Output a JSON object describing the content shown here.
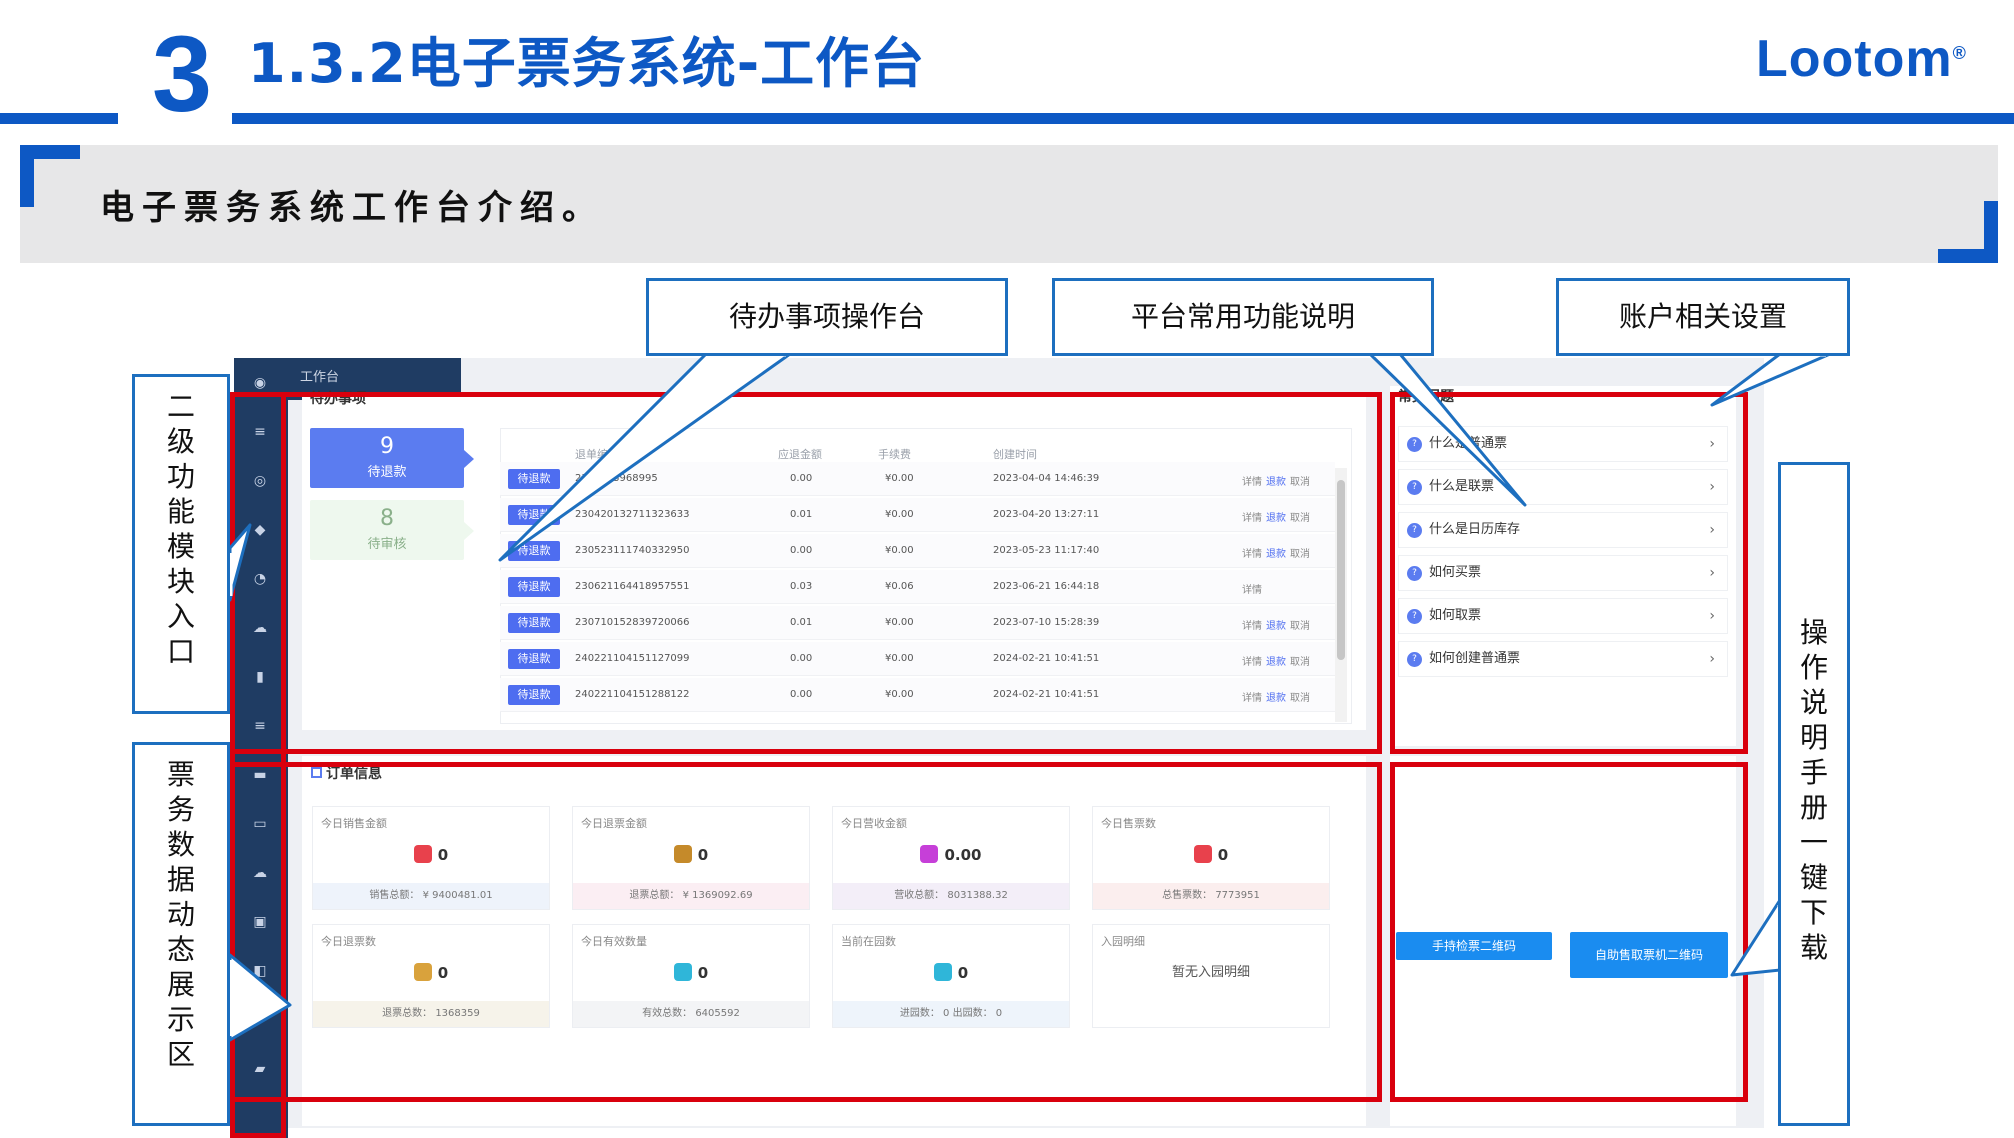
{
  "slide": {
    "number": "3",
    "title": "1.3.2电子票务系统-工作台",
    "logo": "Lootom",
    "logo_mark": "®",
    "subtitle": "电子票务系统工作台介绍。",
    "brand_color": "#0d58c4",
    "frame_color": "#d9000d"
  },
  "callouts": {
    "todo": "待办事项操作台",
    "platform": "平台常用功能说明",
    "account": "账户相关设置",
    "module": "二级功能模块入口",
    "data": "票务数据动态展示区",
    "manual": "操作说明手册一键下载"
  },
  "app": {
    "breadcrumb": "工作台",
    "sidebar_icons": [
      "dashboard-icon",
      "menu-icon",
      "apps-icon",
      "diamond-icon",
      "pie-chart-icon",
      "cloud-icon",
      "document-icon",
      "list-icon",
      "card-icon",
      "screen-icon",
      "cloud-upload-icon",
      "calendar-icon",
      "qr-icon",
      "dropbox-icon",
      "wallet-icon"
    ],
    "todo": {
      "title": "待办事项",
      "cards": [
        {
          "count": "9",
          "label": "待退款"
        },
        {
          "count": "8",
          "label": "待审核"
        }
      ],
      "columns": [
        "退单编号",
        "应退金额",
        "手续费",
        "创建时间"
      ],
      "rows": [
        {
          "tag": "待退款",
          "id": "2304463968995",
          "amount": "0.00",
          "fee": "¥0.00",
          "time": "2023-04-04 14:46:39",
          "detail": "详情",
          "refund": "退款",
          "cancel": "取消"
        },
        {
          "tag": "待退款",
          "id": "230420132711323633",
          "amount": "0.01",
          "fee": "¥0.00",
          "time": "2023-04-20 13:27:11",
          "detail": "详情",
          "refund": "退款",
          "cancel": "取消"
        },
        {
          "tag": "待退款",
          "id": "230523111740332950",
          "amount": "0.00",
          "fee": "¥0.00",
          "time": "2023-05-23 11:17:40",
          "detail": "详情",
          "refund": "退款",
          "cancel": "取消"
        },
        {
          "tag": "待退款",
          "id": "230621164418957551",
          "amount": "0.03",
          "fee": "¥0.06",
          "time": "2023-06-21 16:44:18",
          "detail": "详情",
          "refund": "",
          "cancel": ""
        },
        {
          "tag": "待退款",
          "id": "230710152839720066",
          "amount": "0.01",
          "fee": "¥0.00",
          "time": "2023-07-10 15:28:39",
          "detail": "详情",
          "refund": "退款",
          "cancel": "取消"
        },
        {
          "tag": "待退款",
          "id": "240221104151127099",
          "amount": "0.00",
          "fee": "¥0.00",
          "time": "2024-02-21 10:41:51",
          "detail": "详情",
          "refund": "退款",
          "cancel": "取消"
        },
        {
          "tag": "待退款",
          "id": "240221104151288122",
          "amount": "0.00",
          "fee": "¥0.00",
          "time": "2024-02-21 10:41:51",
          "detail": "详情",
          "refund": "退款",
          "cancel": "取消"
        }
      ]
    },
    "faq": {
      "title": "常见问题",
      "items": [
        "什么是普通票",
        "什么是联票",
        "什么是日历库存",
        "如何买票",
        "如何取票",
        "如何创建普通票"
      ]
    },
    "orders": {
      "title": "订单信息",
      "cards": [
        {
          "title": "今日销售金额",
          "value": "0",
          "footer": "销售总额：  ¥ 9400481.01",
          "icon_color": "#e8414c",
          "foot_bg": "#eef3fb"
        },
        {
          "title": "今日退票金额",
          "value": "0",
          "footer": "退票总额：  ¥ 1369092.69",
          "icon_color": "#c58a2a",
          "foot_bg": "#fbeef3"
        },
        {
          "title": "今日营收金额",
          "value": "0.00",
          "footer": "营收总额：  8031388.32",
          "icon_color": "#c63fd8",
          "foot_bg": "#f3eef8"
        },
        {
          "title": "今日售票数",
          "value": "0",
          "footer": "总售票数：  7773951",
          "icon_color": "#e8414c",
          "foot_bg": "#fbeeee"
        },
        {
          "title": "今日退票数",
          "value": "0",
          "footer": "退票总数：  1368359",
          "icon_color": "#d9a23c",
          "foot_bg": "#f6f3ea"
        },
        {
          "title": "今日有效数量",
          "value": "0",
          "footer": "有效总数：  6405592",
          "icon_color": "#2fb6d9",
          "foot_bg": "#f3f4f6"
        },
        {
          "title": "当前在园数",
          "value": "0",
          "footer": "进园数：  0          出园数：  0",
          "icon_color": "#2fb6d9",
          "foot_bg": "#eef4fb"
        },
        {
          "title": "入园明细",
          "value": "",
          "footer": "",
          "nodata": "暂无入园明细",
          "icon_color": "",
          "foot_bg": "#ffffff"
        }
      ]
    },
    "buttons": {
      "handheld_qr": "手持检票二维码",
      "kiosk_qr": "自助售取票机二维码"
    }
  }
}
